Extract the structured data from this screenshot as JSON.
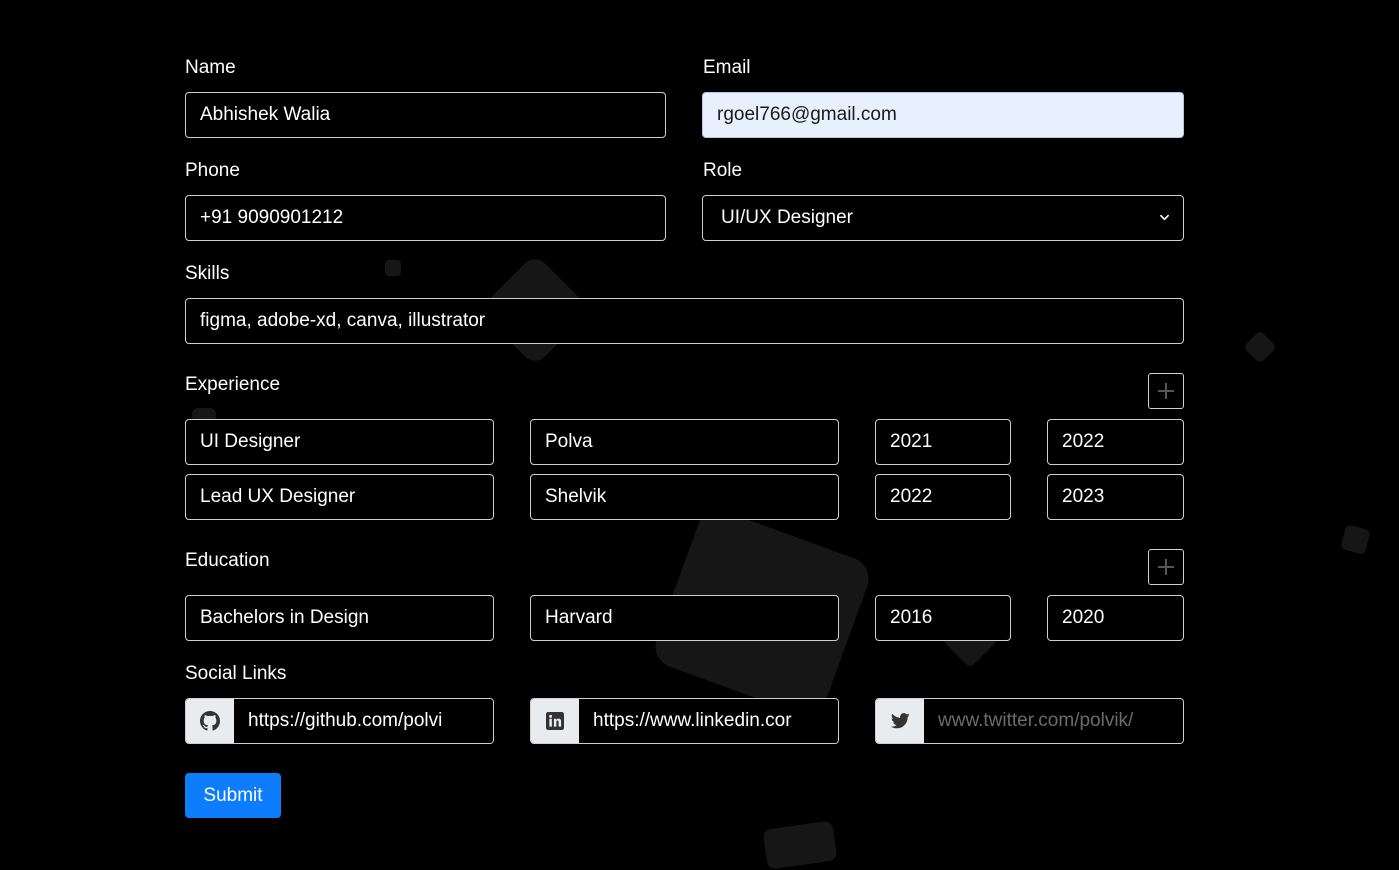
{
  "form": {
    "name": {
      "label": "Name",
      "value": "Abhishek Walia"
    },
    "email": {
      "label": "Email",
      "value": "rgoel766@gmail.com"
    },
    "phone": {
      "label": "Phone",
      "value": "+91 9090901212"
    },
    "role": {
      "label": "Role",
      "value": "UI/UX Designer"
    },
    "skills": {
      "label": "Skills",
      "value": "figma, adobe-xd, canva, illustrator"
    },
    "experience": {
      "label": "Experience",
      "rows": [
        {
          "title": "UI Designer",
          "company": "Polva",
          "start": "2021",
          "end": "2022"
        },
        {
          "title": "Lead UX Designer",
          "company": "Shelvik",
          "start": "2022",
          "end": "2023"
        }
      ]
    },
    "education": {
      "label": "Education",
      "rows": [
        {
          "degree": "Bachelors in Design",
          "school": "Harvard",
          "start": "2016",
          "end": "2020"
        }
      ]
    },
    "social": {
      "label": "Social Links",
      "github": {
        "icon": "github-icon",
        "value": "https://github.com/polvi"
      },
      "linkedin": {
        "icon": "linkedin-icon",
        "value": "https://www.linkedin.cor"
      },
      "twitter": {
        "icon": "twitter-icon",
        "placeholder": "/www.twitter.com/polvik"
      }
    },
    "submit_label": "Submit"
  },
  "colors": {
    "background": "#000000",
    "accent": "#0d7dfd",
    "autofill": "#e8f0fe",
    "addon": "#e9ecef"
  }
}
